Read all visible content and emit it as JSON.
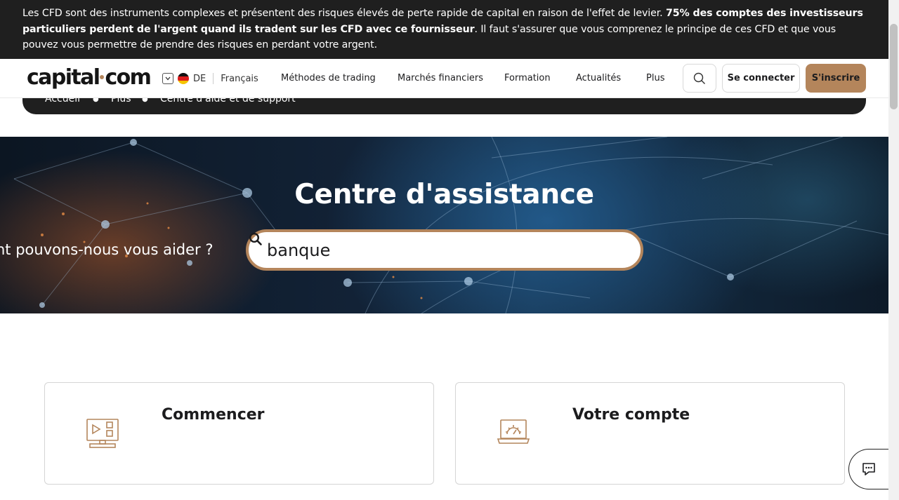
{
  "risk_banner": {
    "text_before": "Les CFD sont des instruments complexes et présentent des risques élevés de perte rapide de capital en raison de l'effet de levier. ",
    "text_bold": "75% des comptes des investisseurs particuliers perdent de l'argent quand ils tradent sur les CFD avec ce fournisseur",
    "text_after": ". Il faut s'assurer que vous comprenez le principe de ces CFD et que vous pouvez vous permettre de prendre des risques en perdant votre argent."
  },
  "header": {
    "logo_left": "capital",
    "logo_right": "com",
    "region_code": "DE",
    "language": "Français",
    "nav": [
      "Méthodes de trading",
      "Marchés financiers",
      "Formation",
      "Actualités",
      "Plus"
    ],
    "login_label": "Se connecter",
    "signup_label": "S'inscrire"
  },
  "breadcrumb": [
    "Accueil",
    "Plus",
    "Centre d'aide et de support"
  ],
  "hero": {
    "title": "Centre d'assistance",
    "prompt": "nt pouvons-nous vous aider ?",
    "search_value": "banque"
  },
  "cards": [
    {
      "title": "Commencer",
      "icon": "video-screen-icon"
    },
    {
      "title": "Votre compte",
      "icon": "laptop-gear-icon"
    }
  ],
  "colors": {
    "accent": "#b4855b",
    "dark": "#1f1f1f"
  }
}
